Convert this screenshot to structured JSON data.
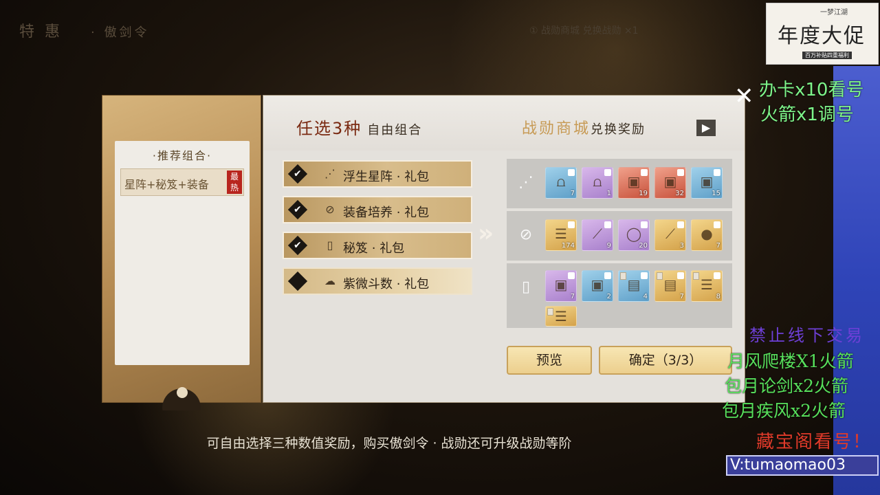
{
  "header": {
    "dim_title": "特 惠",
    "dim_subtitle": "· 傲剑令",
    "dim_center": "① 战勋商城 兑换战勋 ×1"
  },
  "recommend": {
    "title": "·推荐组合·",
    "item_label": "星阵+秘笈+装备",
    "hot_badge": "最热"
  },
  "panel": {
    "title_main": "任选3种",
    "title_sub": "自由组合",
    "shop_title": "战勋商城",
    "shop_sub": "兑换奖励",
    "shop_arrow": "▶"
  },
  "options": [
    {
      "label": "浮生星阵 · 礼包",
      "checked": true,
      "icon": "constellation-icon"
    },
    {
      "label": "装备培养 · 礼包",
      "checked": true,
      "icon": "equipment-icon"
    },
    {
      "label": "秘笈 · 礼包",
      "checked": true,
      "icon": "manual-icon"
    },
    {
      "label": "紫微斗数 · 礼包",
      "checked": false,
      "icon": "astrology-icon"
    }
  ],
  "rewards": [
    {
      "row_icon": "constellation-icon",
      "items": [
        {
          "quality": "blue",
          "count": "7",
          "glyph": "bell-icon"
        },
        {
          "quality": "purple",
          "count": "1",
          "glyph": "bell-icon"
        },
        {
          "quality": "red",
          "count": "19",
          "glyph": "chest-icon"
        },
        {
          "quality": "red",
          "count": "32",
          "glyph": "chest-icon"
        },
        {
          "quality": "blue",
          "count": "15",
          "glyph": "chest-icon"
        }
      ]
    },
    {
      "row_icon": "equipment-icon",
      "items": [
        {
          "quality": "gold",
          "count": "174",
          "glyph": "scroll-icon"
        },
        {
          "quality": "purple",
          "count": "9",
          "glyph": "feather-icon"
        },
        {
          "quality": "purple",
          "count": "20",
          "glyph": "jade-ring-icon"
        },
        {
          "quality": "gold",
          "count": "3",
          "glyph": "feather-icon"
        },
        {
          "quality": "gold",
          "count": "7",
          "glyph": "orb-icon"
        }
      ]
    },
    {
      "row_icon": "manual-icon",
      "items": [
        {
          "quality": "purple",
          "count": "7",
          "glyph": "chest-icon"
        },
        {
          "quality": "blue",
          "count": "2",
          "glyph": "chest-icon"
        },
        {
          "quality": "blue",
          "count": "4",
          "glyph": "book-icon"
        },
        {
          "quality": "gold",
          "count": "7",
          "glyph": "book-icon"
        },
        {
          "quality": "gold",
          "count": "8",
          "glyph": "scroll-icon"
        },
        {
          "quality": "gold",
          "count": "",
          "glyph": "scroll-icon"
        }
      ]
    }
  ],
  "buttons": {
    "preview": "预览",
    "confirm": "确定（3/3）"
  },
  "caption": "可自由选择三种数值奖励，购买傲剑令 · 战勋还可升级战勋等阶",
  "overlay": {
    "logo_small": "一梦江湖",
    "logo_main": "年度大促",
    "logo_sub": "百万补贴四重福利",
    "promo_line1": "办卡x10看号",
    "promo_line2": "火箭x1调号",
    "ban_text": "禁止线下交易",
    "notice1": "月风爬楼X1火箭",
    "notice2": "包月论剑x2火箭",
    "notice3": "包月疾风x2火箭",
    "treasure": "藏宝阁看号！",
    "vtag": "V:tumaomao03"
  },
  "colors": {
    "accent_red": "#7a2a12",
    "gold": "#c79a54",
    "promo_green": "#7ef48a",
    "hot_red": "#b8251e",
    "strip_blue": "#2f44b8"
  }
}
